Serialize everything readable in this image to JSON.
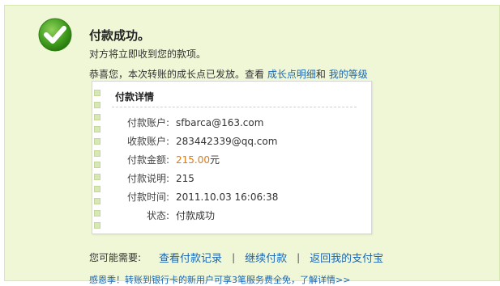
{
  "status": {
    "title": "付款成功。",
    "subtitle": "对方将立即收到您的款项。"
  },
  "growth": {
    "text": "恭喜您，本次转账的成长点已发放。查看",
    "link1": "成长点明细",
    "conj": "和",
    "link2": "我的等级"
  },
  "details": {
    "title": "付款详情",
    "rows": [
      {
        "label": "付款账户:",
        "value": "sfbarca@163.com"
      },
      {
        "label": "收款账户:",
        "value": "283442339@qq.com"
      },
      {
        "label": "付款金额:",
        "amount": "215.00",
        "unit": "元"
      },
      {
        "label": "付款说明:",
        "value": "215"
      },
      {
        "label": "付款时间:",
        "value": "2011.10.03 16:06:38"
      },
      {
        "label": "状态:",
        "value": "付款成功"
      }
    ]
  },
  "next": {
    "label": "您可能需要:",
    "actions": [
      "查看付款记录",
      "继续付款",
      "返回我的支付宝"
    ],
    "separator": "|"
  },
  "promo": "感恩季！转账到银行卡的新用户可享3笔服务费全免，了解详情>>",
  "colors": {
    "panel_bg": "#eff7d7",
    "link": "#1a66b3",
    "amount": "#e07a12",
    "check_green": "#3d9a1c"
  }
}
